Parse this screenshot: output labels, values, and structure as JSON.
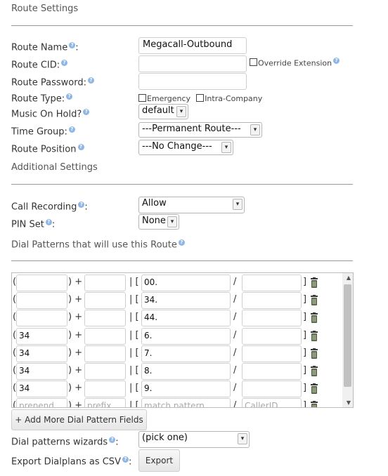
{
  "sections": {
    "route_settings": "Route Settings",
    "additional_settings": "Additional Settings",
    "dial_patterns": "Dial Patterns that will use this Route"
  },
  "fields": {
    "route_name": {
      "label": "Route Name",
      "suffix": ":",
      "value": "Megacall-Outbound"
    },
    "route_cid": {
      "label": "Route CID:",
      "value": "",
      "override_label": "Override Extension"
    },
    "route_password": {
      "label": "Route Password:",
      "value": ""
    },
    "route_type": {
      "label": "Route Type:",
      "emergency_label": "Emergency",
      "intracompany_label": "Intra-Company"
    },
    "music_on_hold": {
      "label": "Music On Hold?",
      "value": "default"
    },
    "time_group": {
      "label": "Time Group:",
      "value": "---Permanent Route---"
    },
    "route_position": {
      "label": "Route Position",
      "value": "---No Change---"
    },
    "call_recording": {
      "label": "Call Recording",
      "suffix": ":",
      "value": "Allow"
    },
    "pin_set": {
      "label": "PIN Set",
      "suffix": ":",
      "value": "None"
    },
    "dial_wizards": {
      "label": "Dial patterns wizards",
      "suffix": ":",
      "value": "(pick one)"
    },
    "export_csv": {
      "label": "Export Dialplans as CSV",
      "suffix": ":",
      "button": "Export"
    }
  },
  "dial_pattern_rows": [
    {
      "prepend": "",
      "prefix": "",
      "match": "00.",
      "callerid": ""
    },
    {
      "prepend": "",
      "prefix": "",
      "match": "34.",
      "callerid": ""
    },
    {
      "prepend": "",
      "prefix": "",
      "match": "44.",
      "callerid": ""
    },
    {
      "prepend": "34",
      "prefix": "",
      "match": "6.",
      "callerid": ""
    },
    {
      "prepend": "34",
      "prefix": "",
      "match": "7.",
      "callerid": ""
    },
    {
      "prepend": "34",
      "prefix": "",
      "match": "8.",
      "callerid": ""
    },
    {
      "prepend": "34",
      "prefix": "",
      "match": "9.",
      "callerid": ""
    }
  ],
  "placeholder_row": {
    "prepend": "prepend",
    "prefix": "prefix",
    "match": "match pattern",
    "callerid": "CallerID"
  },
  "symbols": {
    "open_paren": "(",
    "close_paren_plus": ") +",
    "pipe_bracket": "| [",
    "slash": "/",
    "close_bracket": "]"
  },
  "add_more_button": "+ Add More Dial Pattern Fields",
  "help_glyph": "?"
}
